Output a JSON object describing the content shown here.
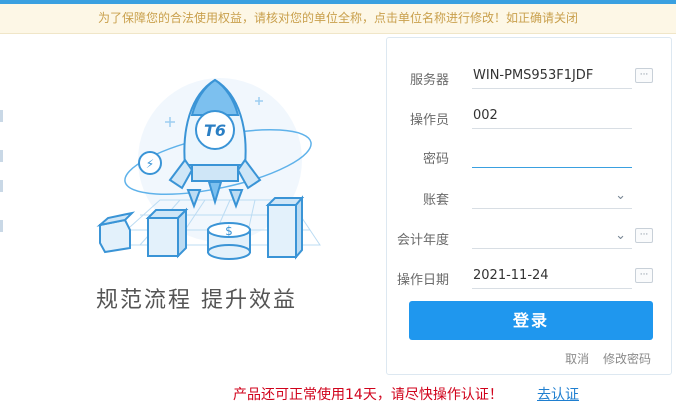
{
  "notice": {
    "text": "为了保障您的合法使用权益，请核对您的单位全称，点击单位名称进行修改！如正确请关闭"
  },
  "illustration": {
    "badge": "T6",
    "coin_symbol": "$",
    "bolt_symbol": "⚡"
  },
  "slogan": "规范流程  提升效益",
  "form": {
    "server": {
      "label": "服务器",
      "value": "WIN-PMS953F1JDF",
      "more": "···"
    },
    "operator": {
      "label": "操作员",
      "value": "002"
    },
    "password": {
      "label": "密码",
      "value": ""
    },
    "account": {
      "label": "账套",
      "value": "",
      "chevron": "⌄"
    },
    "fiscal_year": {
      "label": "会计年度",
      "value": "",
      "chevron": "⌄",
      "more": "···"
    },
    "op_date": {
      "label": "操作日期",
      "value": "2021-11-24",
      "more": "···"
    },
    "login_button": "登录",
    "cancel_link": "取消",
    "change_password_link": "修改密码"
  },
  "footer": {
    "warning": "产品还可正常使用14天，请尽快操作认证！",
    "certify_link": "去认证"
  },
  "colors": {
    "accent": "#1f97ee",
    "notice_bg": "#fdf7e6",
    "notice_text": "#c9a04d",
    "warning_text": "#d0021b",
    "link": "#1f7fd0"
  }
}
